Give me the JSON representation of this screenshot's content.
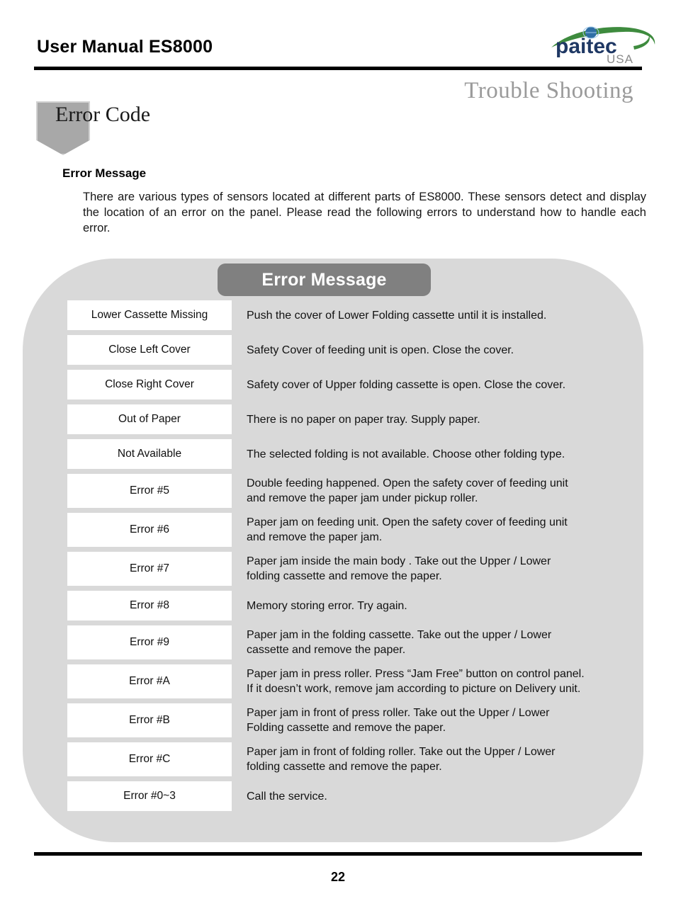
{
  "header": {
    "manual_title": "User Manual ES8000",
    "logo": {
      "wordmark": "paitec",
      "subtext": "USA",
      "wordmark_color": "#1f3864",
      "swoosh_color": "#3e8b3e",
      "globe_color": "#2f6ea5",
      "subtext_color": "#8a8a8a"
    }
  },
  "section": {
    "chapter_title": "Trouble Shooting",
    "badge_title": "Error Code",
    "badge_color": "#a8a8a8"
  },
  "intro": {
    "heading": "Error Message",
    "paragraph": "There are various types of sensors located at different parts of ES8000. These sensors detect and display the location of an error on the panel. Please read the following errors to understand how to handle each error."
  },
  "error_table": {
    "banner_label": "Error Message",
    "banner_color": "#808080",
    "panel_color": "#d9d9d9",
    "rows": [
      {
        "code": "Lower Cassette Missing",
        "lines": [
          "Push the cover of Lower Folding cassette until it is installed."
        ]
      },
      {
        "code": "Close Left Cover",
        "lines": [
          "Safety Cover of  feeding unit is open. Close the cover."
        ]
      },
      {
        "code": "Close Right Cover",
        "lines": [
          "Safety cover of Upper folding cassette is open. Close the cover."
        ]
      },
      {
        "code": "Out of Paper",
        "lines": [
          "There is no paper on paper tray. Supply paper."
        ]
      },
      {
        "code": "Not Available",
        "lines": [
          "The selected folding is not available. Choose other folding type."
        ]
      },
      {
        "code": "Error #5",
        "lines": [
          "Double feeding happened. Open the safety cover of feeding unit",
          "and remove the paper jam under pickup roller."
        ]
      },
      {
        "code": "Error #6",
        "lines": [
          "Paper jam on feeding unit. Open the safety cover of feeding unit",
          "and remove the paper jam."
        ]
      },
      {
        "code": "Error #7",
        "lines": [
          "Paper jam inside the main body . Take out the Upper / Lower",
          "folding cassette and remove the paper."
        ]
      },
      {
        "code": "Error #8",
        "lines": [
          "Memory storing error. Try again."
        ]
      },
      {
        "code": "Error #9",
        "lines": [
          "Paper jam in the folding cassette. Take out the upper / Lower",
          "cassette and remove the paper."
        ]
      },
      {
        "code": "Error #A",
        "lines": [
          "Paper jam in press roller. Press “Jam Free” button on control panel.",
          "If it doesn’t work, remove jam according to picture on Delivery unit."
        ]
      },
      {
        "code": "Error #B",
        "lines": [
          "Paper jam in front of press roller. Take out the Upper / Lower",
          "Folding cassette and remove the paper."
        ]
      },
      {
        "code": "Error #C",
        "lines": [
          "Paper jam in front of folding roller. Take out the Upper / Lower",
          "folding cassette and remove the paper."
        ]
      },
      {
        "code": "Error #0~3",
        "lines": [
          "Call the service."
        ]
      }
    ]
  },
  "footer": {
    "page_number": "22"
  }
}
